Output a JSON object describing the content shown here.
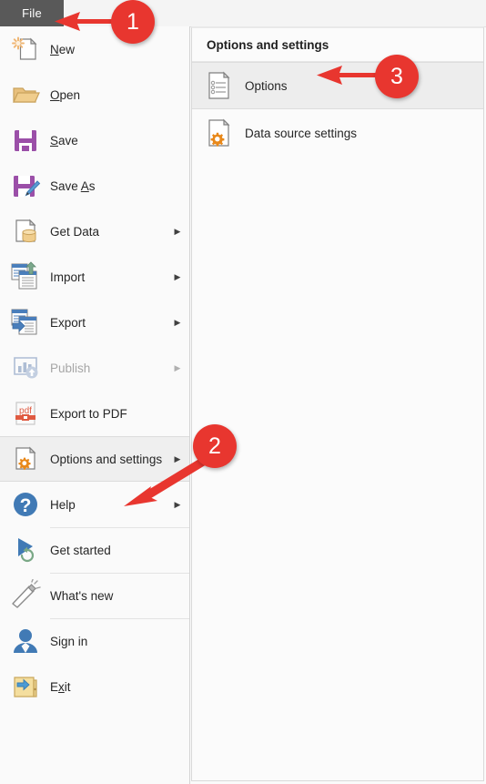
{
  "window": {
    "file_tab_label": "File",
    "accent_red": "#E8362F",
    "file_tab_bg": "#595959",
    "highlight_bg": "#EFEFEF"
  },
  "sidebar": {
    "items": [
      {
        "id": "new",
        "label": "New",
        "access_key": "N",
        "icon": "new-page-icon",
        "submenu": false,
        "disabled": false,
        "highlighted": false,
        "separator_above": false
      },
      {
        "id": "open",
        "label": "Open",
        "access_key": "O",
        "icon": "open-folder-icon",
        "submenu": false,
        "disabled": false,
        "highlighted": false,
        "separator_above": false
      },
      {
        "id": "save",
        "label": "Save",
        "access_key": "S",
        "icon": "floppy-disk-icon",
        "submenu": false,
        "disabled": false,
        "highlighted": false,
        "separator_above": false
      },
      {
        "id": "save-as",
        "label": "Save As",
        "access_key": "A",
        "icon": "floppy-disk-pencil-icon",
        "submenu": false,
        "disabled": false,
        "highlighted": false,
        "separator_above": false
      },
      {
        "id": "get-data",
        "label": "Get Data",
        "access_key": "",
        "icon": "page-database-icon",
        "submenu": true,
        "disabled": false,
        "highlighted": false,
        "separator_above": false
      },
      {
        "id": "import",
        "label": "Import",
        "access_key": "",
        "icon": "import-arrow-up-icon",
        "submenu": true,
        "disabled": false,
        "highlighted": false,
        "separator_above": false
      },
      {
        "id": "export",
        "label": "Export",
        "access_key": "",
        "icon": "export-arrow-down-icon",
        "submenu": true,
        "disabled": false,
        "highlighted": false,
        "separator_above": false
      },
      {
        "id": "publish",
        "label": "Publish",
        "access_key": "",
        "icon": "publish-chart-upload-icon",
        "submenu": true,
        "disabled": true,
        "highlighted": false,
        "separator_above": false
      },
      {
        "id": "export-to-pdf",
        "label": "Export to PDF",
        "access_key": "",
        "icon": "pdf-icon",
        "submenu": false,
        "disabled": false,
        "highlighted": false,
        "separator_above": false
      },
      {
        "id": "options-and-settings",
        "label": "Options and settings",
        "access_key": "",
        "icon": "page-gear-icon",
        "submenu": true,
        "disabled": false,
        "highlighted": true,
        "separator_above": true
      },
      {
        "id": "help",
        "label": "Help",
        "access_key": "",
        "icon": "question-circle-icon",
        "submenu": true,
        "disabled": false,
        "highlighted": false,
        "separator_above": false
      },
      {
        "id": "get-started",
        "label": "Get started",
        "access_key": "",
        "icon": "play-refresh-icon",
        "submenu": false,
        "disabled": false,
        "highlighted": false,
        "separator_above": true
      },
      {
        "id": "whats-new",
        "label": "What's new",
        "access_key": "",
        "icon": "megaphone-icon",
        "submenu": false,
        "disabled": false,
        "highlighted": false,
        "separator_above": true
      },
      {
        "id": "sign-in",
        "label": "Sign in",
        "access_key": "",
        "icon": "person-icon",
        "submenu": false,
        "disabled": false,
        "highlighted": false,
        "separator_above": true
      },
      {
        "id": "exit",
        "label": "Exit",
        "access_key": "i",
        "icon": "exit-folder-icon",
        "submenu": false,
        "disabled": false,
        "highlighted": false,
        "separator_above": false
      }
    ]
  },
  "right_panel": {
    "title": "Options and settings",
    "items": [
      {
        "id": "options",
        "label": "Options",
        "icon": "page-list-icon",
        "selected": true
      },
      {
        "id": "data-source-settings",
        "label": "Data source settings",
        "icon": "page-gear-icon",
        "selected": false
      }
    ]
  },
  "annotations": {
    "markers": [
      {
        "id": "marker-1",
        "number": "1",
        "points_to": "file-tab",
        "arrow": "left"
      },
      {
        "id": "marker-2",
        "number": "2",
        "points_to": "options-and-settings",
        "arrow": "diagonal-down-left"
      },
      {
        "id": "marker-3",
        "number": "3",
        "points_to": "options",
        "arrow": "left"
      }
    ]
  }
}
